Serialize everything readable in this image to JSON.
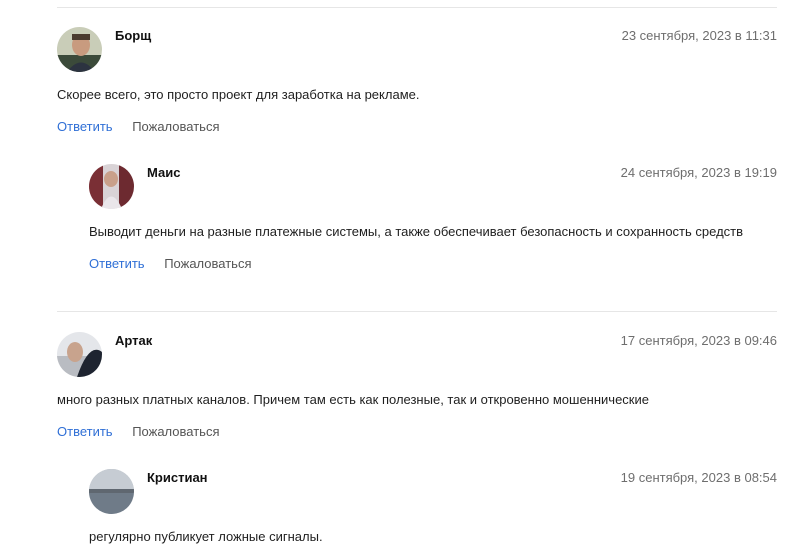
{
  "comments": [
    {
      "author": "Борщ",
      "date": "23 сентября, 2023 в 11:31",
      "text": "Скорее всего, это просто проект для заработка на рекламе.",
      "reply_label": "Ответить",
      "report_label": "Пожаловаться",
      "replies": [
        {
          "author": "Маис",
          "date": "24 сентября, 2023 в 19:19",
          "text": "Выводит деньги на разные платежные системы, а также обеспечивает безопасность и сохранность средств",
          "reply_label": "Ответить",
          "report_label": "Пожаловаться"
        }
      ]
    },
    {
      "author": "Артак",
      "date": "17 сентября, 2023 в 09:46",
      "text": "много разных платных каналов. Причем там есть как полезные, так и откровенно мошеннические",
      "reply_label": "Ответить",
      "report_label": "Пожаловаться",
      "replies": [
        {
          "author": "Кристиан",
          "date": "19 сентября, 2023 в 08:54",
          "text": "регулярно публикует ложные сигналы."
        }
      ]
    }
  ],
  "colors": {
    "link": "#2f6fd6",
    "muted": "#6e6e6e",
    "divider": "#e6e6e6"
  }
}
